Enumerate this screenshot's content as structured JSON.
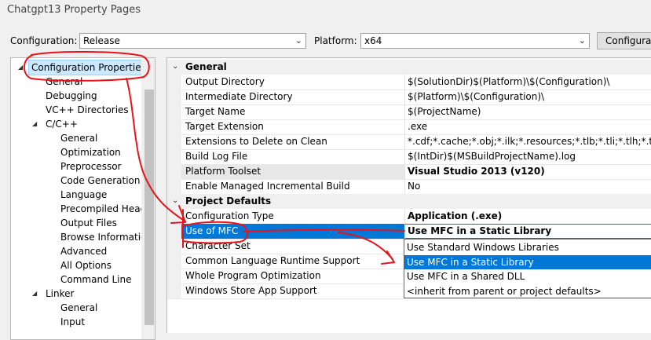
{
  "window": {
    "title": "Chatgpt13 Property Pages"
  },
  "toolbar": {
    "configuration_label": "Configuration:",
    "configuration_value": "Release",
    "platform_label": "Platform:",
    "platform_value": "x64",
    "config_manager_button": "Configurat"
  },
  "tree": {
    "items": [
      {
        "label": "Configuration Properties",
        "expanded": true
      },
      {
        "label": "General"
      },
      {
        "label": "Debugging"
      },
      {
        "label": "VC++ Directories"
      },
      {
        "label": "C/C++",
        "expanded": true
      },
      {
        "label": "General"
      },
      {
        "label": "Optimization"
      },
      {
        "label": "Preprocessor"
      },
      {
        "label": "Code Generation"
      },
      {
        "label": "Language"
      },
      {
        "label": "Precompiled Heade"
      },
      {
        "label": "Output Files"
      },
      {
        "label": "Browse Information"
      },
      {
        "label": "Advanced"
      },
      {
        "label": "All Options"
      },
      {
        "label": "Command Line"
      },
      {
        "label": "Linker",
        "expanded": true
      },
      {
        "label": "General"
      },
      {
        "label": "Input"
      }
    ]
  },
  "grid": {
    "general_category": "General",
    "general_rows": [
      {
        "name": "Output Directory",
        "value": "$(SolutionDir)$(Platform)\\$(Configuration)\\"
      },
      {
        "name": "Intermediate Directory",
        "value": "$(Platform)\\$(Configuration)\\"
      },
      {
        "name": "Target Name",
        "value": "$(ProjectName)"
      },
      {
        "name": "Target Extension",
        "value": ".exe"
      },
      {
        "name": "Extensions to Delete on Clean",
        "value": "*.cdf;*.cache;*.obj;*.ilk;*.resources;*.tlb;*.tli;*.tlh;*.tmp;*.rsp"
      },
      {
        "name": "Build Log File",
        "value": "$(IntDir)$(MSBuildProjectName).log"
      },
      {
        "name": "Platform Toolset",
        "value": "Visual Studio 2013 (v120)",
        "bold": true
      },
      {
        "name": "Enable Managed Incremental Build",
        "value": "No"
      }
    ],
    "defaults_category": "Project Defaults",
    "defaults_rows": [
      {
        "name": "Configuration Type",
        "value": "Application (.exe)",
        "bold": true
      },
      {
        "name": "Use of MFC",
        "value": "Use MFC in a Static Library",
        "bold": true
      },
      {
        "name": "Character Set",
        "value": ""
      },
      {
        "name": "Common Language Runtime Support",
        "value": ""
      },
      {
        "name": "Whole Program Optimization",
        "value": ""
      },
      {
        "name": "Windows Store App Support",
        "value": ""
      }
    ]
  },
  "dropdown": {
    "options": [
      "Use Standard Windows Libraries",
      "Use MFC in a Static Library",
      "Use MFC in a Shared DLL",
      "<inherit from parent or project defaults>"
    ],
    "selected_index": 1
  },
  "colors": {
    "selection": "#0078d7",
    "annotation": "#e8141c",
    "tree_selection": "#cce8ff"
  }
}
